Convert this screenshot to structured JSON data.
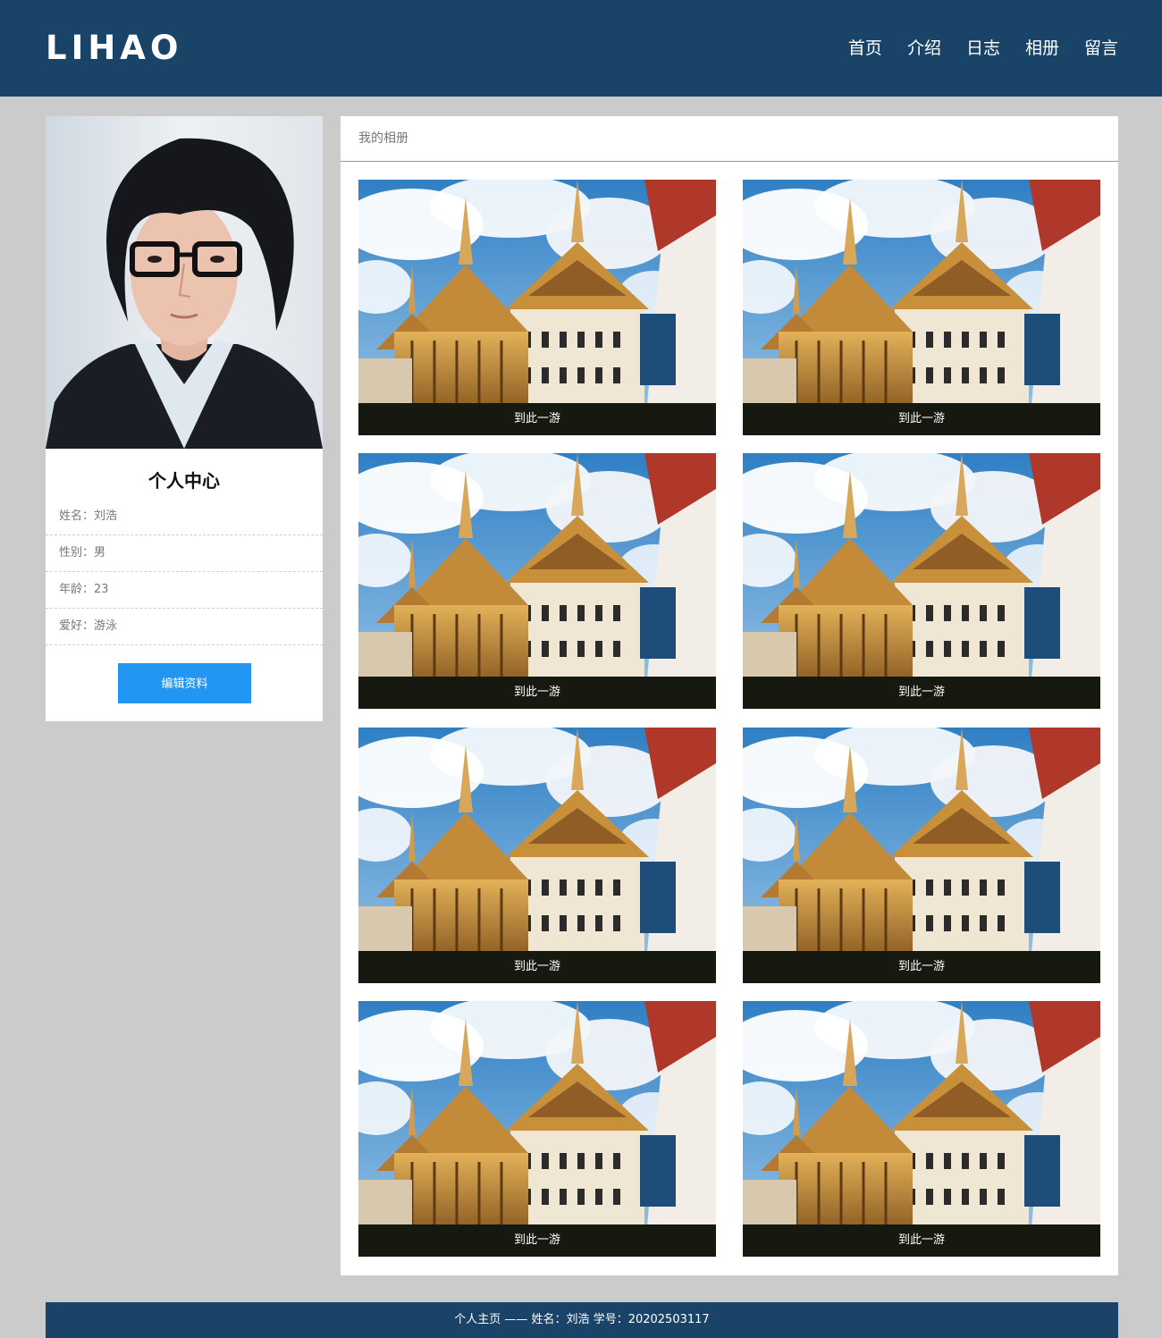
{
  "header": {
    "logo": "LIHAO",
    "nav": [
      {
        "label": "首页"
      },
      {
        "label": "介绍"
      },
      {
        "label": "日志"
      },
      {
        "label": "相册"
      },
      {
        "label": "留言"
      }
    ]
  },
  "profile": {
    "title": "个人中心",
    "rows": [
      {
        "label": "姓名：刘浩"
      },
      {
        "label": "性别：男"
      },
      {
        "label": "年龄：23"
      },
      {
        "label": "爱好：游泳"
      }
    ],
    "edit_label": "编辑资料"
  },
  "album": {
    "title": "我的相册",
    "photos": [
      {
        "caption": "到此一游"
      },
      {
        "caption": "到此一游"
      },
      {
        "caption": "到此一游"
      },
      {
        "caption": "到此一游"
      },
      {
        "caption": "到此一游"
      },
      {
        "caption": "到此一游"
      },
      {
        "caption": "到此一游"
      },
      {
        "caption": "到此一游"
      }
    ]
  },
  "footer": {
    "text": "个人主页 —— 姓名：刘浩    学号：20202503117"
  },
  "colors": {
    "header_bg": "#1a4467",
    "page_bg": "#cbcbcb",
    "button": "#2196f3"
  }
}
